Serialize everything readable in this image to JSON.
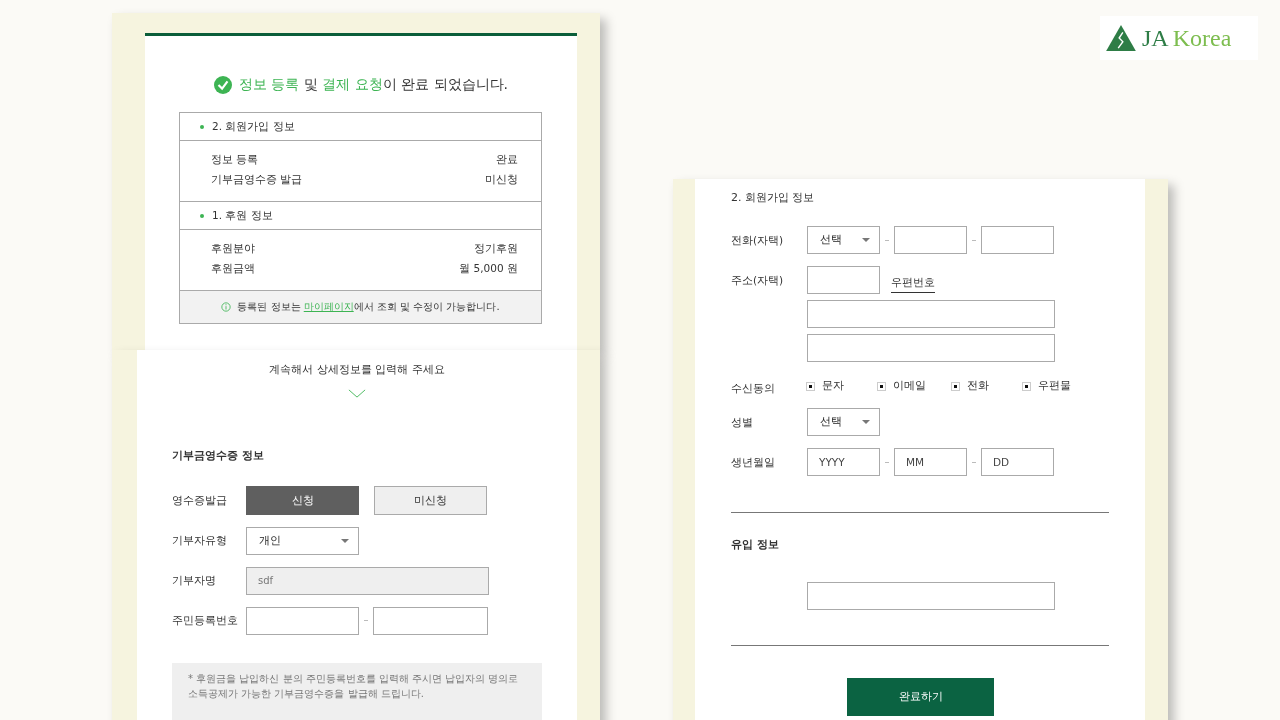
{
  "logo": {
    "mark": "JA",
    "name": "Korea"
  },
  "completion": {
    "headline": [
      {
        "text": "정보 등록",
        "highlight": true
      },
      {
        "text": " 및 ",
        "highlight": false
      },
      {
        "text": "결제 요청",
        "highlight": true
      },
      {
        "text": "이 완료 되었습니다.",
        "highlight": false
      }
    ],
    "sections": [
      {
        "title": "2. 회원가입 정보",
        "rows": [
          {
            "label": "정보 등록",
            "value": "완료"
          },
          {
            "label": "기부금영수증 발급",
            "value": "미신청"
          }
        ]
      },
      {
        "title": "1. 후원 정보",
        "rows": [
          {
            "label": "후원분야",
            "value": "정기후원"
          },
          {
            "label": "후원금액",
            "value": "월 5,000 원"
          }
        ]
      }
    ],
    "note": {
      "before": "등록된 정보는 ",
      "link": "마이페이지",
      "after": "에서 조회 및 수정이 가능합니다."
    }
  },
  "receipt": {
    "prompt": "계속해서 상세정보를 입력해 주세요",
    "title": "기부금영수증 정보",
    "fields": [
      {
        "kind": "toggle",
        "label": "영수증발급",
        "options": [
          {
            "label": "신청",
            "selected": true
          },
          {
            "label": "미신청",
            "selected": false
          }
        ]
      },
      {
        "kind": "select",
        "label": "기부자유형",
        "value": "개인"
      },
      {
        "kind": "readonly",
        "label": "기부자명",
        "value": "sdf"
      },
      {
        "kind": "split",
        "label": "주민등록번호"
      }
    ],
    "note": "* 후원금을 납입하신 분의 주민등록번호를 입력해 주시면 납입자의 명의로 소득공제가 가능한 기부금영수증을 발급해 드립니다."
  },
  "member": {
    "title": "2. 회원가입 정보",
    "fields": [
      {
        "kind": "phone",
        "label": "전화(자택)",
        "select": "선택"
      },
      {
        "kind": "address",
        "label": "주소(자택)",
        "link": "우편번호"
      },
      {
        "kind": "checks",
        "label": "수신동의",
        "options": [
          {
            "label": "문자",
            "checked": true
          },
          {
            "label": "이메일",
            "checked": true
          },
          {
            "label": "전화",
            "checked": true
          },
          {
            "label": "우편물",
            "checked": true
          }
        ]
      },
      {
        "kind": "select",
        "label": "성별",
        "value": "선택"
      },
      {
        "kind": "date",
        "label": "생년월일",
        "placeholders": [
          "YYYY",
          "MM",
          "DD"
        ]
      }
    ],
    "source_title": "유입 정보",
    "submit": "완료하기"
  }
}
